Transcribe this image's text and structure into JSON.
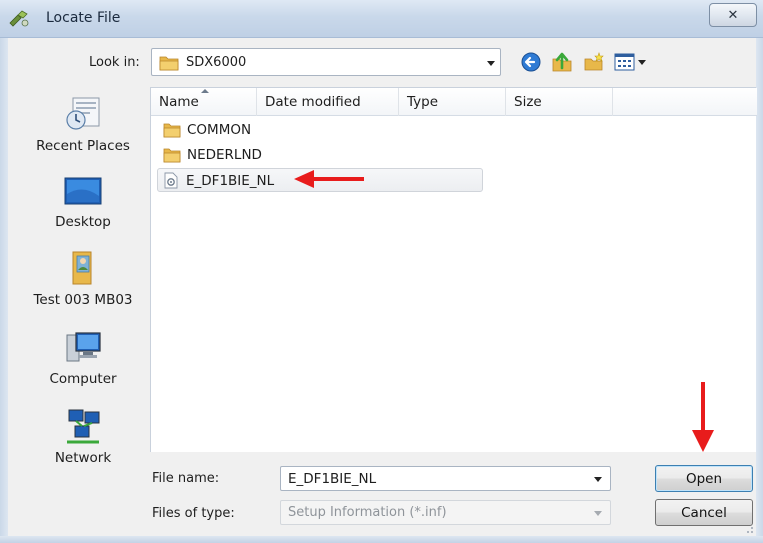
{
  "window": {
    "title": "Locate File",
    "close_glyph": "✕"
  },
  "look_in": {
    "label": "Look in:",
    "value": "SDX6000"
  },
  "toolbar": {
    "icons": [
      "back-icon",
      "up-folder-icon",
      "new-folder-icon",
      "views-menu-icon"
    ]
  },
  "places": [
    {
      "label": "Recent Places",
      "icon": "recent-places-icon"
    },
    {
      "label": "Desktop",
      "icon": "desktop-icon"
    },
    {
      "label": "Test 003 MB03",
      "icon": "user-folder-icon"
    },
    {
      "label": "Computer",
      "icon": "computer-icon"
    },
    {
      "label": "Network",
      "icon": "network-icon"
    }
  ],
  "columns": [
    "Name",
    "Date modified",
    "Type",
    "Size"
  ],
  "files": [
    {
      "name": "COMMON",
      "kind": "folder"
    },
    {
      "name": "NEDERLND",
      "kind": "folder"
    },
    {
      "name": "E_DF1BIE_NL",
      "kind": "setup-information",
      "selected": true
    }
  ],
  "file_name": {
    "label": "File name:",
    "value": "E_DF1BIE_NL"
  },
  "file_type": {
    "label": "Files of type:",
    "value": "Setup Information (*.inf)"
  },
  "buttons": {
    "open": "Open",
    "cancel": "Cancel"
  },
  "annotations": {
    "arrow_color": "#e81c1c"
  },
  "colors": {
    "title_bar": "#c9d8ea",
    "folder": "#e8b84a",
    "default_button_border": "#3c7fb1"
  }
}
